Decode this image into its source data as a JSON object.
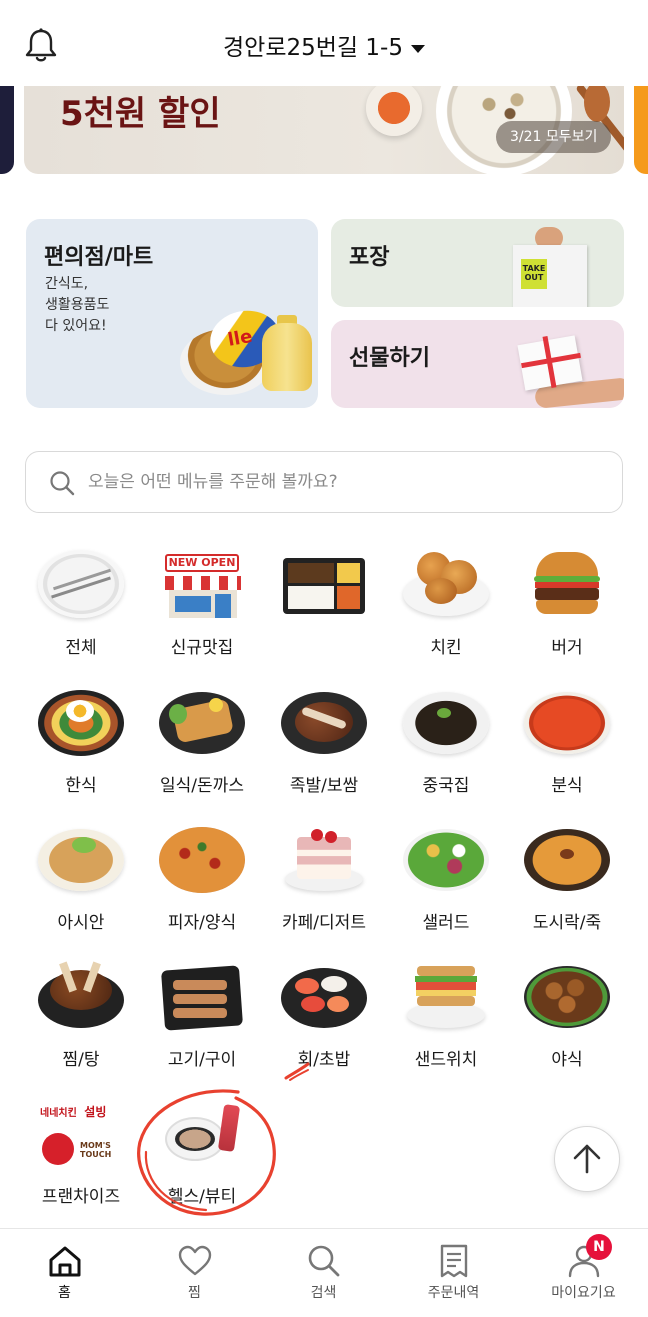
{
  "header": {
    "address": "경안로25번길 1-5",
    "bell_icon": "bell-icon",
    "dropdown_icon": "caret-down-icon"
  },
  "banner": {
    "title": "5천원 할인",
    "pager": "3/21 모두보기"
  },
  "shortcuts": {
    "mart": {
      "title": "편의점/마트",
      "subtitle": "간식도,\n생활용품도\n다 있어요!",
      "product_text": "lle"
    },
    "pack": {
      "title": "포장",
      "bag_text": "TAKE OUT"
    },
    "gift": {
      "title": "선물하기"
    }
  },
  "search": {
    "placeholder": "오늘은 어떤 메뉴를 주문해 볼까요?",
    "icon": "search-icon"
  },
  "categories": [
    {
      "label": "전체"
    },
    {
      "label": "신규맛집",
      "sign": "NEW OPEN"
    },
    {
      "label": ""
    },
    {
      "label": "치킨"
    },
    {
      "label": "버거"
    },
    {
      "label": "한식"
    },
    {
      "label": "일식/돈까스"
    },
    {
      "label": "족발/보쌈"
    },
    {
      "label": "중국집"
    },
    {
      "label": "분식"
    },
    {
      "label": "아시안"
    },
    {
      "label": "피자/양식"
    },
    {
      "label": "카페/디저트"
    },
    {
      "label": "샐러드"
    },
    {
      "label": "도시락/죽"
    },
    {
      "label": "찜/탕"
    },
    {
      "label": "고기/구이"
    },
    {
      "label": "회/초밥"
    },
    {
      "label": "샌드위치"
    },
    {
      "label": "야식"
    },
    {
      "label": "프랜차이즈",
      "logos": [
        "네네치킨",
        "설빙",
        "MOM'S TOUCH"
      ]
    },
    {
      "label": "헬스/뷰티"
    }
  ],
  "tabbar": {
    "items": [
      {
        "label": "홈",
        "icon": "home-icon",
        "active": true
      },
      {
        "label": "찜",
        "icon": "heart-icon",
        "active": false
      },
      {
        "label": "검색",
        "icon": "search-icon",
        "active": false
      },
      {
        "label": "주문내역",
        "icon": "receipt-icon",
        "active": false
      },
      {
        "label": "마이요기요",
        "icon": "user-icon",
        "active": false
      }
    ],
    "badge": "N"
  },
  "colors": {
    "banner_title": "#6a1414",
    "accent_red": "#e6113b",
    "annotation": "#e8412f"
  }
}
